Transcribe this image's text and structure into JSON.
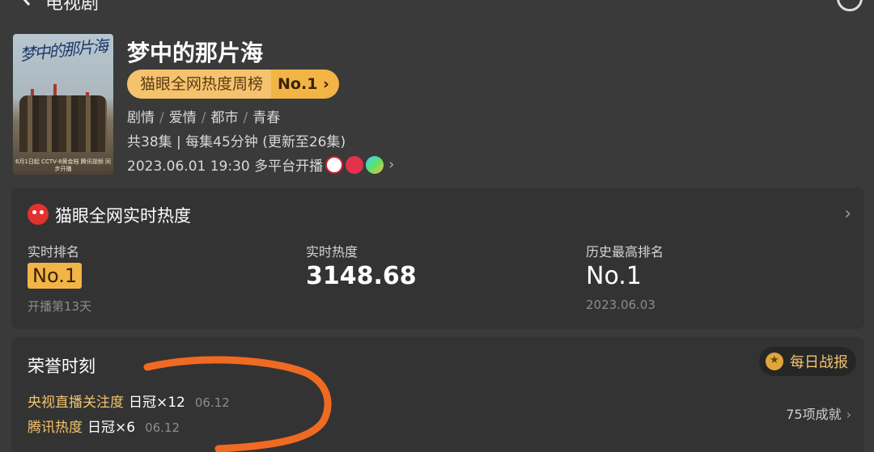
{
  "nav": {
    "back_label": "电视剧"
  },
  "show": {
    "poster_title": "梦中的那片海",
    "poster_caption": "6月1日起 CCTV-8黄金档 腾讯视频 同步开播",
    "title": "梦中的那片海",
    "rank_label": "猫眼全网热度周榜",
    "rank_value": "No.1",
    "genres": [
      "剧情",
      "爱情",
      "都市",
      "青春"
    ],
    "episodes": "共38集 | 每集45分钟 (更新至26集)",
    "airdate": "2023.06.01 19:30 多平台开播",
    "platforms": [
      "cctv-icon",
      "red-platform-icon",
      "play-platform-icon"
    ]
  },
  "realtime": {
    "title": "猫眼全网实时热度",
    "stats": [
      {
        "label": "实时排名",
        "value": "No.1",
        "sub": "开播第13天"
      },
      {
        "label": "实时热度",
        "value": "3148.68",
        "sub": ""
      },
      {
        "label": "历史最高排名",
        "value": "No.1",
        "sub": "2023.06.03"
      }
    ]
  },
  "honors": {
    "title": "荣誉时刻",
    "daily_report": "每日战报",
    "items": [
      {
        "label": "央视直播关注度",
        "count": "日冠×12",
        "date": "06.12"
      },
      {
        "label": "腾讯热度",
        "count": "日冠×6",
        "date": "06.12"
      }
    ],
    "achievements": "75项成就"
  },
  "colors": {
    "accent": "#f2b445",
    "annotation": "#f06a22",
    "background": "#3a3a3a"
  }
}
